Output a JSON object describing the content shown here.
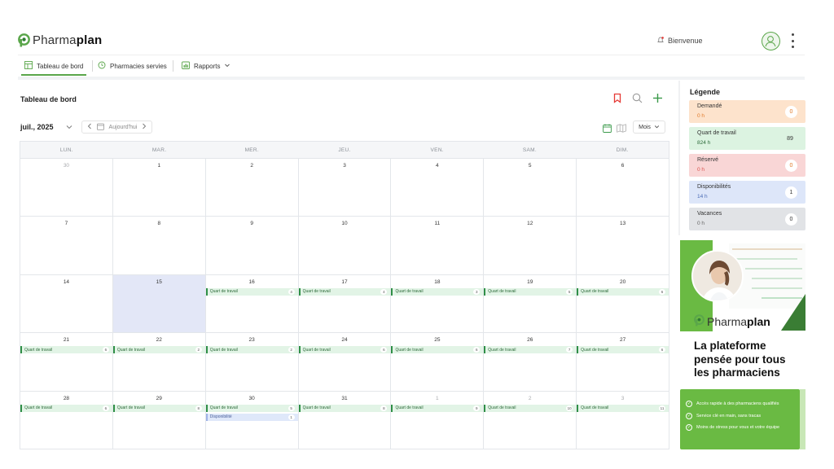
{
  "app": {
    "logo_light": "Pharma",
    "logo_bold": "plan",
    "greeting": "Bienvenue"
  },
  "nav": {
    "items": [
      {
        "label": "Tableau de bord",
        "icon": "dashboard-icon",
        "active": true
      },
      {
        "label": "Pharmacies servies",
        "icon": "history-icon",
        "active": false
      },
      {
        "label": "Rapports",
        "icon": "report-icon",
        "active": false
      }
    ]
  },
  "main": {
    "title": "Tableau de bord",
    "month": "juil., 2025",
    "today_label": "Aujourd'hui",
    "view_label": "Mois"
  },
  "calendar": {
    "weekdays": [
      "LUN.",
      "MAR.",
      "MER.",
      "JEU.",
      "VEN.",
      "SAM.",
      "DIM."
    ],
    "event_label": "Quart de travail",
    "dispo_label": "Disponibilité",
    "weeks": [
      [
        {
          "d": "30",
          "m": true
        },
        {
          "d": "1"
        },
        {
          "d": "2"
        },
        {
          "d": "3"
        },
        {
          "d": "4"
        },
        {
          "d": "5"
        },
        {
          "d": "6"
        }
      ],
      [
        {
          "d": "7"
        },
        {
          "d": "8"
        },
        {
          "d": "9"
        },
        {
          "d": "10"
        },
        {
          "d": "11"
        },
        {
          "d": "12"
        },
        {
          "d": "13"
        }
      ],
      [
        {
          "d": "14"
        },
        {
          "d": "15",
          "today": true
        },
        {
          "d": "16",
          "ev": "4"
        },
        {
          "d": "17",
          "ev": "4"
        },
        {
          "d": "18",
          "ev": "3"
        },
        {
          "d": "19",
          "ev": "5"
        },
        {
          "d": "20",
          "ev": "6"
        }
      ],
      [
        {
          "d": "21",
          "ev": "6"
        },
        {
          "d": "22",
          "ev": "2"
        },
        {
          "d": "23",
          "ev": "2"
        },
        {
          "d": "24",
          "ev": "6"
        },
        {
          "d": "25",
          "ev": "6"
        },
        {
          "d": "26",
          "ev": "7"
        },
        {
          "d": "27",
          "ev": "6"
        }
      ],
      [
        {
          "d": "28",
          "ev": "6"
        },
        {
          "d": "29",
          "ev": "8"
        },
        {
          "d": "30",
          "ev": "5",
          "dispo": "1"
        },
        {
          "d": "31",
          "ev": "8"
        },
        {
          "d": "1",
          "m": true,
          "ev": "9"
        },
        {
          "d": "2",
          "m": true,
          "ev": "10"
        },
        {
          "d": "3",
          "m": true,
          "ev": "11"
        }
      ]
    ]
  },
  "legend": {
    "title": "Légende",
    "items": [
      {
        "name": "Demandé",
        "hours": "0 h",
        "count": "0",
        "bg": "#fde3cc",
        "hc": "#e07a2a"
      },
      {
        "name": "Quart de travail",
        "hours": "824 h",
        "count": "89",
        "bg": "#dcf3e1",
        "hc": "#2d6b3a"
      },
      {
        "name": "Réservé",
        "hours": "0 h",
        "count": "0",
        "bg": "#f9d6d6",
        "hc": "#d9534f"
      },
      {
        "name": "Disponibilités",
        "hours": "14 h",
        "count": "1",
        "bg": "#dde6f9",
        "hc": "#4a6bb5"
      },
      {
        "name": "Vacances",
        "hours": "0 h",
        "count": "0",
        "bg": "#e1e3e6",
        "hc": "#666666"
      }
    ]
  },
  "promo": {
    "logo_light": "Pharma",
    "logo_bold": "plan",
    "headline": "La plateforme pensée pour tous les pharmaciens",
    "bullets": [
      "Accès rapide à des pharmaciens qualifiés",
      "Service clé en main, sans tracas",
      "Moins de stress pour vous et votre équipe"
    ]
  },
  "colors": {
    "brand_green": "#5aa64a",
    "promo_green": "#6aba43",
    "today_bg": "#e3e7f7",
    "bookmark_red": "#e53935"
  }
}
